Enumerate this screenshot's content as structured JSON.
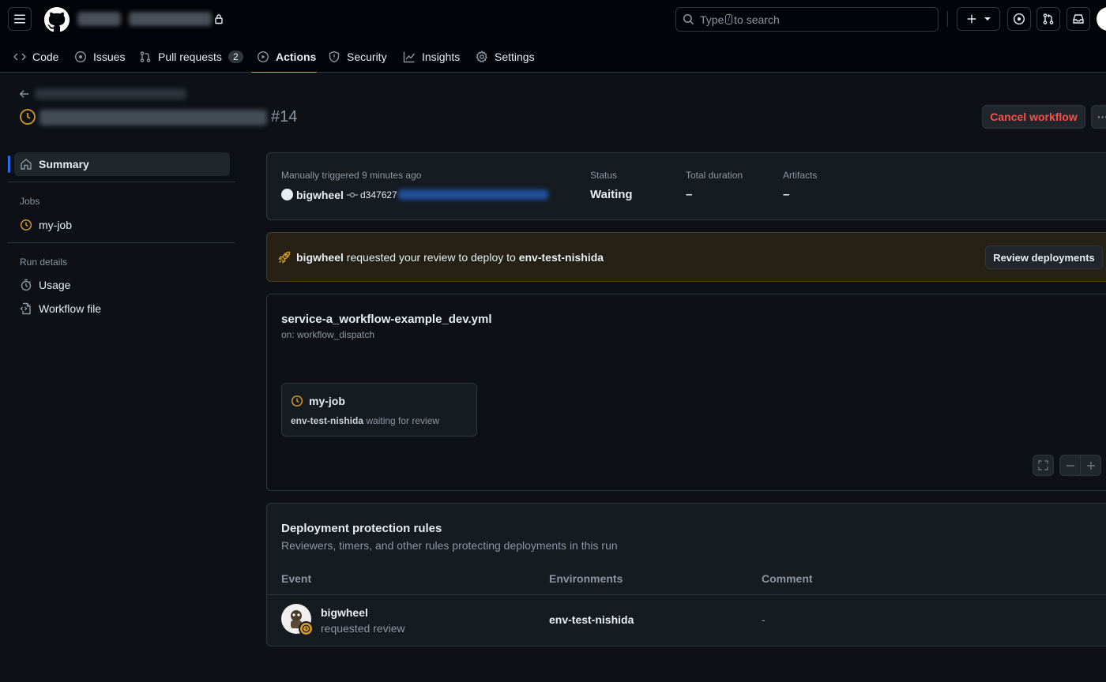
{
  "header": {
    "search_prefix": "Type",
    "search_key": "/",
    "search_suffix": "to search"
  },
  "repo_tabs": [
    {
      "label": "Code"
    },
    {
      "label": "Issues"
    },
    {
      "label": "Pull requests",
      "count": "2"
    },
    {
      "label": "Actions"
    },
    {
      "label": "Security"
    },
    {
      "label": "Insights"
    },
    {
      "label": "Settings"
    }
  ],
  "run": {
    "number": "#14",
    "cancel_label": "Cancel workflow",
    "more_label": "···"
  },
  "sidebar": {
    "summary": "Summary",
    "jobs_heading": "Jobs",
    "job": "my-job",
    "run_details_heading": "Run details",
    "usage": "Usage",
    "workflow_file": "Workflow file"
  },
  "summary": {
    "trigger": "Manually triggered 9 minutes ago",
    "actor": "bigwheel",
    "commit": "d347627",
    "status_label": "Status",
    "status_value": "Waiting",
    "duration_label": "Total duration",
    "duration_value": "–",
    "artifacts_label": "Artifacts",
    "artifacts_value": "–"
  },
  "review_banner": {
    "actor": "bigwheel",
    "text": "requested your review to deploy to",
    "environment": "env-test-nishida",
    "button": "Review deployments"
  },
  "workflow": {
    "file": "service-a_workflow-example_dev.yml",
    "trigger": "on: workflow_dispatch",
    "job_name": "my-job",
    "job_env": "env-test-nishida",
    "job_status": "waiting for review"
  },
  "protection": {
    "title": "Deployment protection rules",
    "subtitle": "Reviewers, timers, and other rules protecting deployments in this run",
    "columns": [
      "Event",
      "Environments",
      "Comment"
    ],
    "row": {
      "user": "bigwheel",
      "event": "requested review",
      "environment": "env-test-nishida",
      "comment": "-"
    }
  },
  "colors": {
    "accent_orange": "#d29922",
    "danger": "#f85149",
    "tab_underline": "#fd8c73",
    "sidebar_active_bar": "#1f6feb"
  },
  "icons": [
    "hamburger-icon",
    "github-logo-icon",
    "lock-icon",
    "search-icon",
    "plus-icon",
    "issue-icon",
    "pull-request-icon",
    "inbox-icon",
    "clock-icon",
    "home-icon",
    "stopwatch-icon",
    "file-code-icon",
    "rocket-icon",
    "commit-icon",
    "fullscreen-icon",
    "minus-icon"
  ]
}
